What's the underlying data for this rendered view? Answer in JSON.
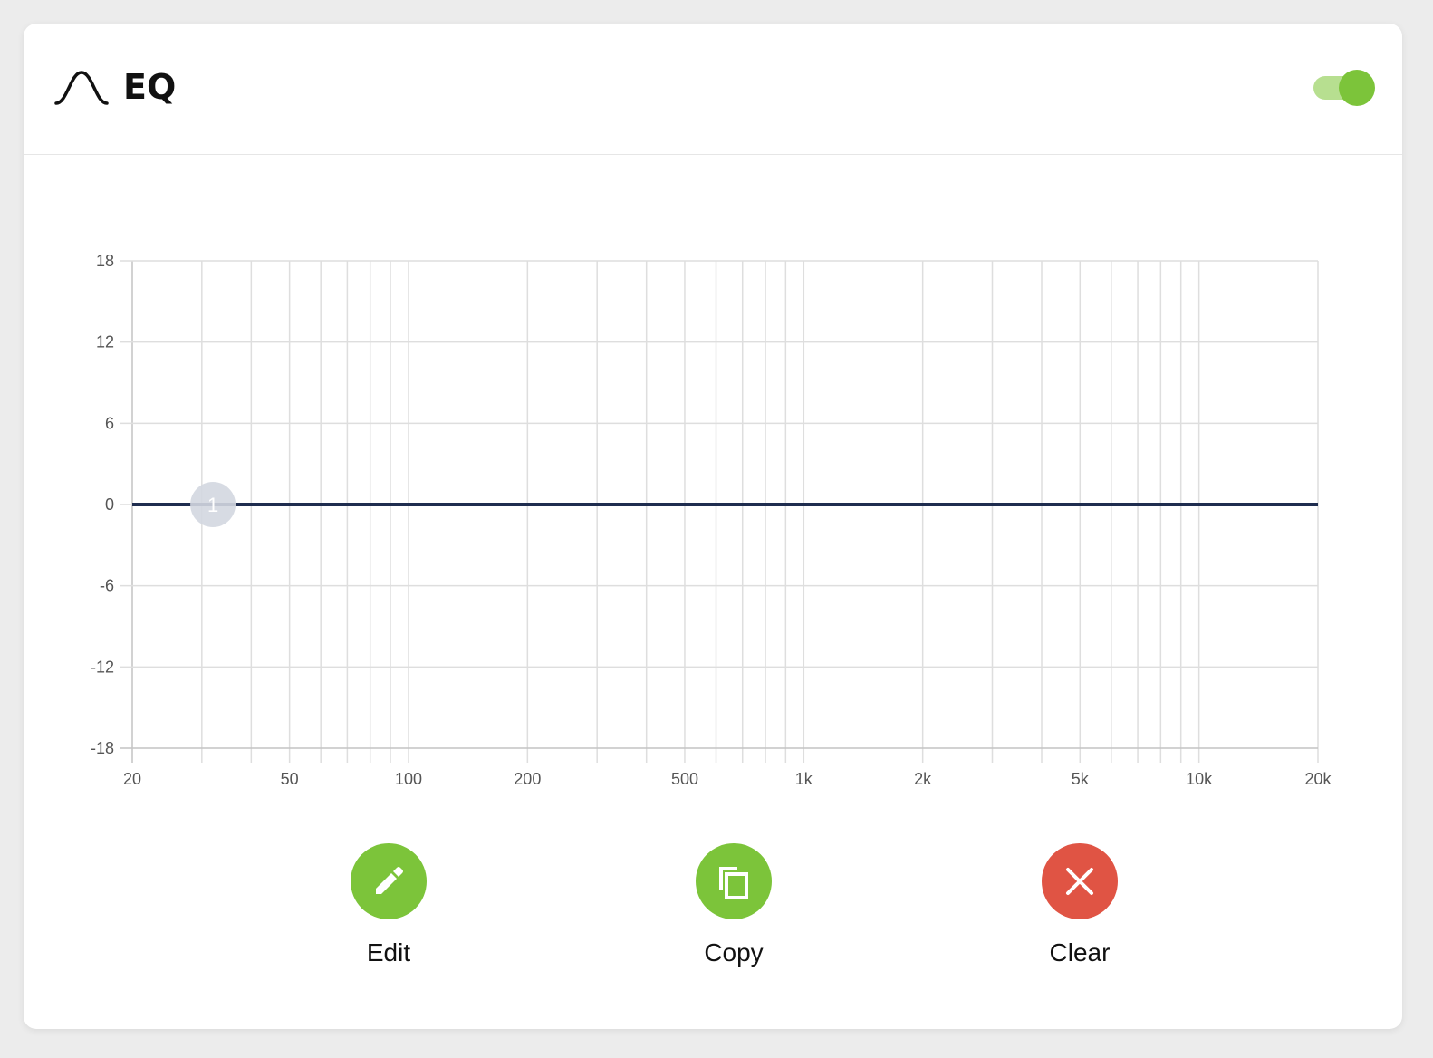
{
  "header": {
    "title": "EQ",
    "icon": "bell-curve-icon",
    "enabled": true
  },
  "colors": {
    "accent_green": "#7cc43a",
    "toggle_track": "#b7df90",
    "clear_red": "#e05444",
    "curve": "#1f2d4f",
    "band_marker": "#d3d7e0"
  },
  "chart_data": {
    "type": "line",
    "x_scale": "log",
    "xlim": [
      20,
      20000
    ],
    "ylim": [
      -18,
      18
    ],
    "x_ticks": [
      {
        "value": 20,
        "label": "20"
      },
      {
        "value": 50,
        "label": "50"
      },
      {
        "value": 100,
        "label": "100"
      },
      {
        "value": 200,
        "label": "200"
      },
      {
        "value": 500,
        "label": "500"
      },
      {
        "value": 1000,
        "label": "1k"
      },
      {
        "value": 2000,
        "label": "2k"
      },
      {
        "value": 5000,
        "label": "5k"
      },
      {
        "value": 10000,
        "label": "10k"
      },
      {
        "value": 20000,
        "label": "20k"
      }
    ],
    "y_ticks": [
      {
        "value": 18,
        "label": "18"
      },
      {
        "value": 12,
        "label": "12"
      },
      {
        "value": 6,
        "label": "6"
      },
      {
        "value": 0,
        "label": "0"
      },
      {
        "value": -6,
        "label": "-6"
      },
      {
        "value": -12,
        "label": "-12"
      },
      {
        "value": -18,
        "label": "-18"
      }
    ],
    "grid_freqs": [
      20,
      30,
      40,
      50,
      60,
      70,
      80,
      90,
      100,
      200,
      300,
      400,
      500,
      600,
      700,
      800,
      900,
      1000,
      2000,
      3000,
      4000,
      5000,
      6000,
      7000,
      8000,
      9000,
      10000,
      20000
    ],
    "series": [
      {
        "x": [
          20,
          20000
        ],
        "y": [
          0,
          0
        ]
      }
    ],
    "bands": [
      {
        "label": "1",
        "freq": 32,
        "gain": 0
      }
    ],
    "grid": true
  },
  "actions": [
    {
      "label": "Edit",
      "icon": "pencil-icon",
      "color": "#7cc43a"
    },
    {
      "label": "Copy",
      "icon": "copy-icon",
      "color": "#7cc43a"
    },
    {
      "label": "Clear",
      "icon": "close-icon",
      "color": "#e05444"
    }
  ]
}
